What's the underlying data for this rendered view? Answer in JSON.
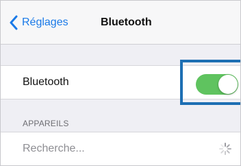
{
  "nav": {
    "back_label": "Réglages",
    "title": "Bluetooth"
  },
  "bluetooth_row": {
    "label": "Bluetooth",
    "toggle_on": true
  },
  "devices_section": {
    "header": "APPAREILS",
    "status": "Recherche..."
  },
  "colors": {
    "accent": "#1a7ae8",
    "toggle_on": "#5fc35f",
    "highlight": "#1d6fb3",
    "background": "#efeff4"
  },
  "icons": {
    "back": "chevron-left-icon",
    "spinner": "loading-spinner-icon"
  }
}
